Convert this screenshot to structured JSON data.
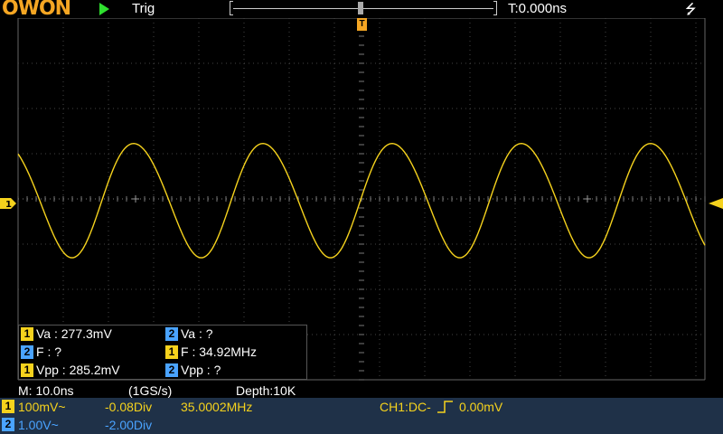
{
  "header": {
    "brand": "OWON",
    "trigger_label": "Trig",
    "time_offset": "T:0.000ns",
    "trigger_marker": "T",
    "usb_icon": "usb-icon"
  },
  "channel_marker": "1",
  "measurements": {
    "rows": [
      [
        {
          "ch": "1",
          "text": "Va : 277.3mV"
        },
        {
          "ch": "2",
          "text": "Va :    ?"
        }
      ],
      [
        {
          "ch": "2",
          "text": "F :     ?"
        },
        {
          "ch": "1",
          "text": "F : 34.92MHz"
        }
      ],
      [
        {
          "ch": "1",
          "text": "Vpp : 285.2mV"
        },
        {
          "ch": "2",
          "text": "Vpp :     ?"
        }
      ]
    ]
  },
  "info": {
    "timebase": "M: 10.0ns",
    "sample_rate": "(1GS/s)",
    "depth": "Depth:10K"
  },
  "channels": {
    "ch1": {
      "num": "1",
      "scale": "100mV~",
      "offset": "-0.08Div",
      "freq": "35.0002MHz",
      "trigger": "CH1:DC-",
      "trigger_level": "0.00mV"
    },
    "ch2": {
      "num": "2",
      "scale": "1.00V~",
      "offset": "-2.00Div"
    }
  },
  "colors": {
    "ch1": "#f5d21d",
    "ch2": "#4aa3ff",
    "bar": "#1f3148"
  }
}
